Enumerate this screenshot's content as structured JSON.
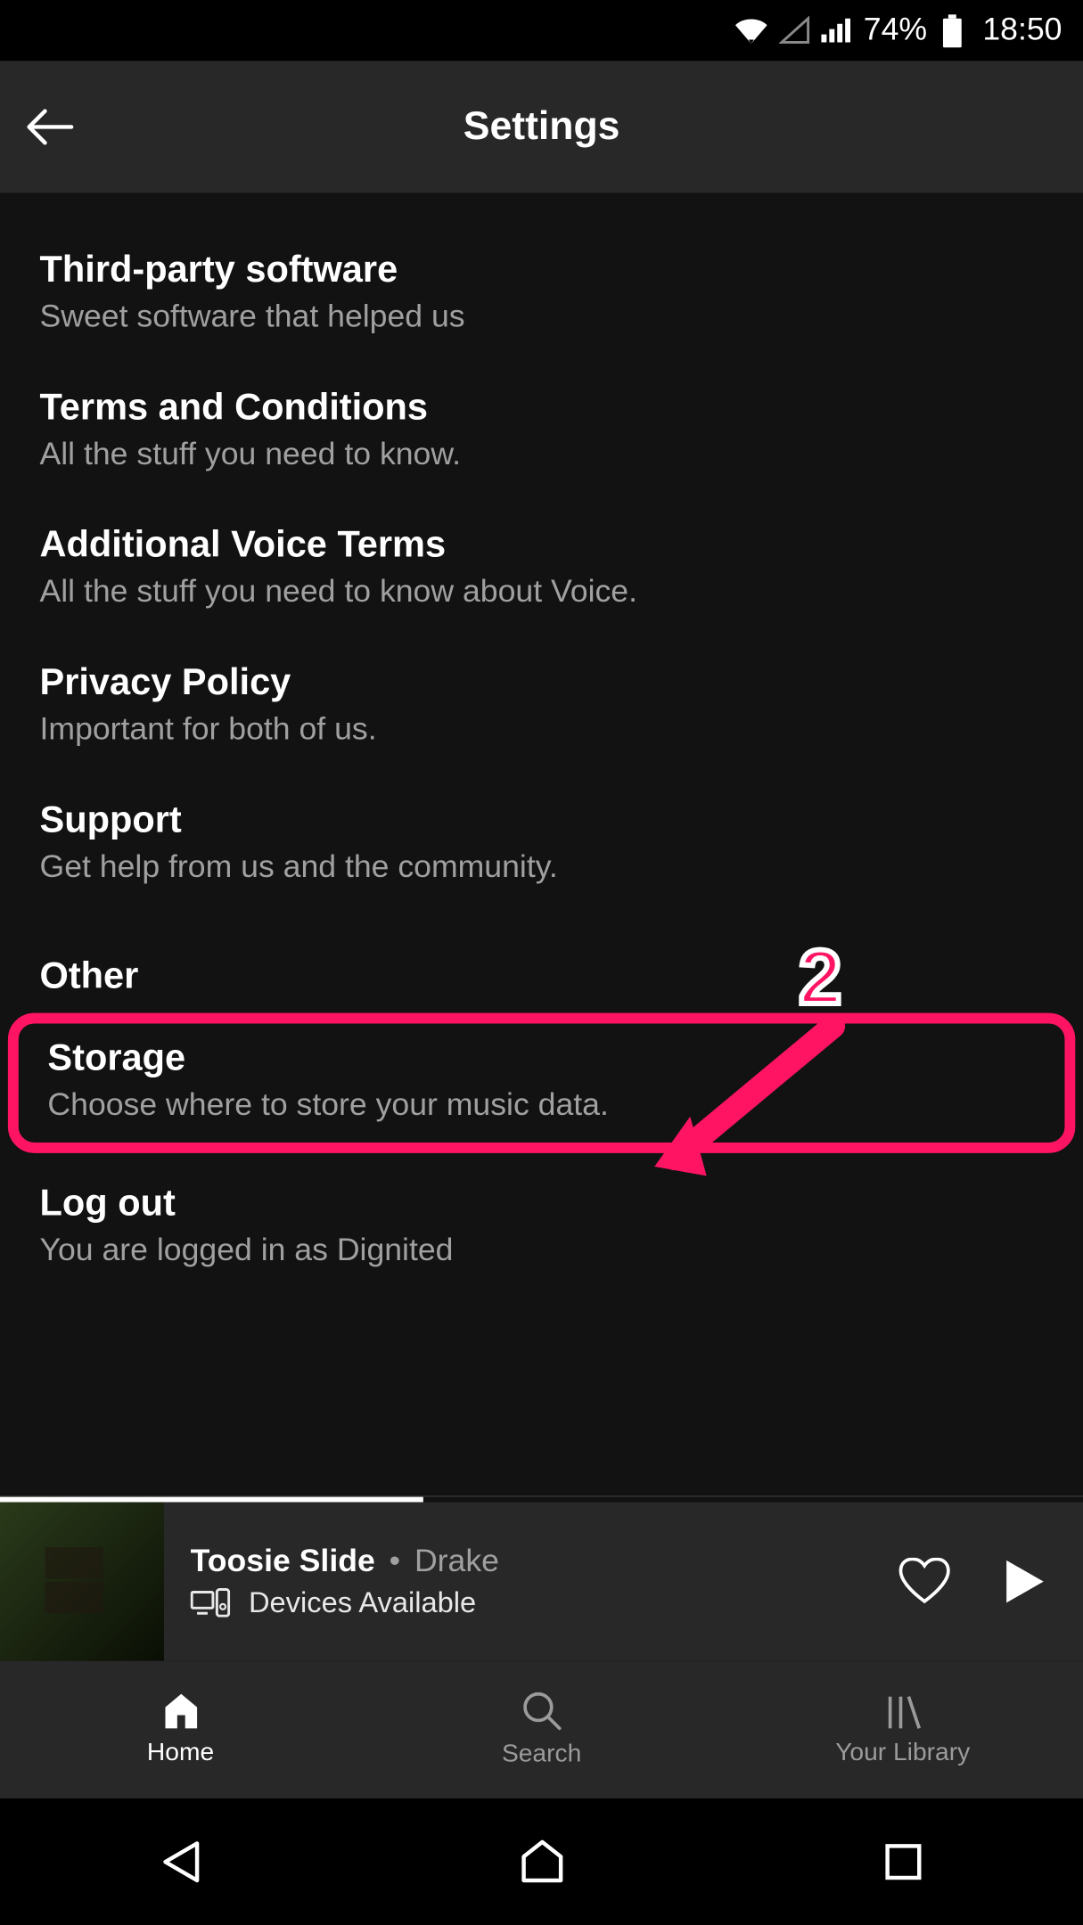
{
  "status_bar": {
    "battery_pct": "74%",
    "time": "18:50"
  },
  "header": {
    "title": "Settings"
  },
  "settings": {
    "items": [
      {
        "title": "Third-party software",
        "sub": "Sweet software that helped us"
      },
      {
        "title": "Terms and Conditions",
        "sub": "All the stuff you need to know."
      },
      {
        "title": "Additional Voice Terms",
        "sub": "All the stuff you need to know about Voice."
      },
      {
        "title": "Privacy Policy",
        "sub": "Important for both of us."
      },
      {
        "title": "Support",
        "sub": "Get help from us and the community."
      }
    ],
    "section_other": "Other",
    "storage": {
      "title": "Storage",
      "sub": "Choose where to store your music data."
    },
    "logout": {
      "title": "Log out",
      "sub": "You are logged in as Dignited"
    }
  },
  "annotation": {
    "number": "2"
  },
  "now_playing": {
    "song": "Toosie Slide",
    "separator": "•",
    "artist": "Drake",
    "devices_label": "Devices Available"
  },
  "bottom_nav": {
    "tabs": [
      {
        "label": "Home"
      },
      {
        "label": "Search"
      },
      {
        "label": "Your Library"
      }
    ]
  }
}
